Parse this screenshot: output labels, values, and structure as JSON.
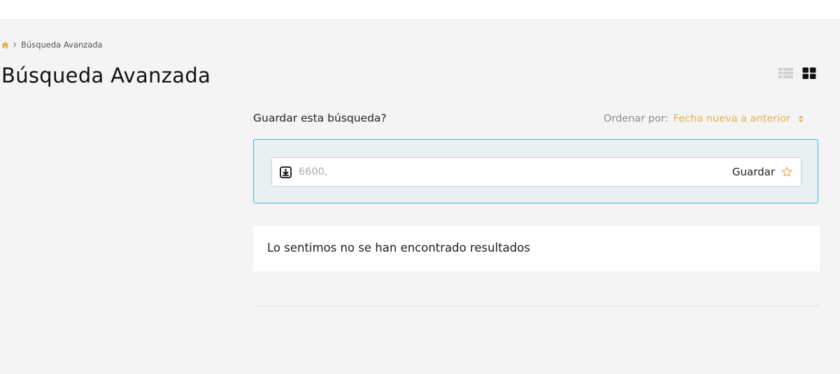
{
  "breadcrumb": {
    "home_icon": "home-icon",
    "separator_icon": "chevron-right-icon",
    "current": "Búsqueda Avanzada"
  },
  "page": {
    "title": "Búsqueda Avanzada"
  },
  "view_toggle": {
    "list_icon": "list-view-icon",
    "grid_icon": "grid-view-icon",
    "active": "grid"
  },
  "save_search": {
    "prompt": "Guardar esta búsqueda?",
    "query_value": "",
    "query_placeholder": "6600,",
    "load_icon": "load-search-icon",
    "save_label": "Guardar",
    "star_icon": "star-outline-icon"
  },
  "sort": {
    "label": "Ordenar por:",
    "value": "Fecha nueva a anterior",
    "arrows_icon": "sort-arrows-icon"
  },
  "results": {
    "empty_message": "Lo sentimos no se han encontrado resultados"
  },
  "colors": {
    "accent": "#e6b14f",
    "panel_border": "#3fb3e0",
    "panel_background": "#e9f0f2",
    "page_background": "#f4f4f4"
  }
}
